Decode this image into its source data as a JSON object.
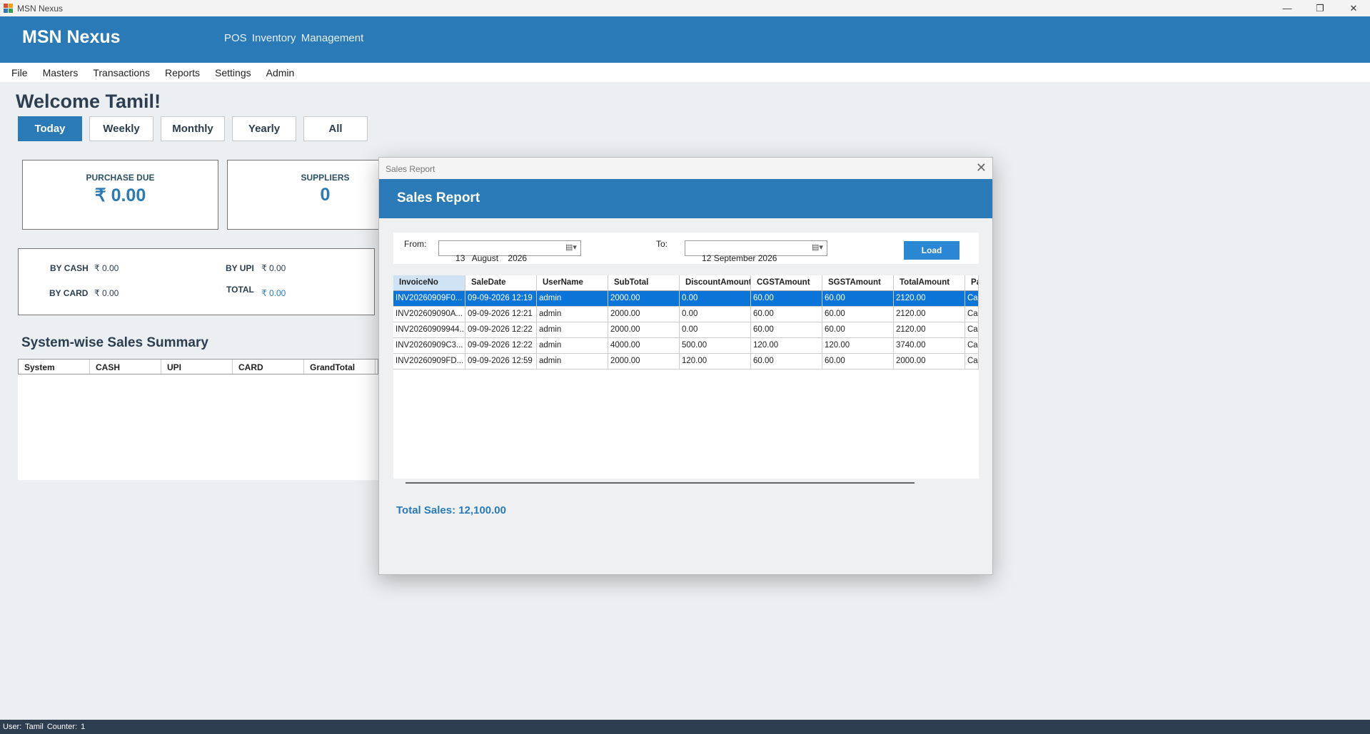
{
  "window": {
    "title": "MSN Nexus",
    "minimize": "—",
    "restore": "❐",
    "close": "✕"
  },
  "header": {
    "brand": "MSN Nexus",
    "subtitle": "POS Inventory Management"
  },
  "menu": [
    "File",
    "Masters",
    "Transactions",
    "Reports",
    "Settings",
    "Admin"
  ],
  "welcome": "Welcome Tamil!",
  "periods": [
    {
      "label": "Today",
      "active": true
    },
    {
      "label": "Weekly",
      "active": false
    },
    {
      "label": "Monthly",
      "active": false
    },
    {
      "label": "Yearly",
      "active": false
    },
    {
      "label": "All",
      "active": false
    }
  ],
  "cards": {
    "purchase_due": {
      "label": "PURCHASE DUE",
      "value": "₹ 0.00"
    },
    "suppliers": {
      "label": "SUPPLIERS",
      "value": "0"
    }
  },
  "payments": {
    "by_cash_label": "BY CASH",
    "by_cash": "₹ 0.00",
    "by_upi_label": "BY UPI",
    "by_upi": "₹ 0.00",
    "by_card_label": "BY CARD",
    "by_card": "₹ 0.00",
    "total_label": "TOTAL",
    "total": "₹ 0.00"
  },
  "summary": {
    "title": "System-wise Sales Summary",
    "columns": [
      "System",
      "CASH",
      "UPI",
      "CARD",
      "GrandTotal"
    ]
  },
  "dialog": {
    "window_title": "Sales Report",
    "close_glyph": "✕",
    "header": "Sales Report",
    "from_label": "From:",
    "from_value": "13   August    2026",
    "to_label": "To:",
    "to_value": "12 September 2026",
    "calendar_glyph": "▤▾",
    "load_label": "Load",
    "columns": [
      "InvoiceNo",
      "SaleDate",
      "UserName",
      "SubTotal",
      "DiscountAmount",
      "CGSTAmount",
      "SGSTAmount",
      "TotalAmount",
      "Pa"
    ],
    "rows": [
      [
        "INV20260909F0...",
        "09-09-2026 12:19",
        "admin",
        "2000.00",
        "0.00",
        "60.00",
        "60.00",
        "2120.00",
        "Ca"
      ],
      [
        "INV2026090​90A...",
        "09-09-2026 12:21",
        "admin",
        "2000.00",
        "0.00",
        "60.00",
        "60.00",
        "2120.00",
        "Ca"
      ],
      [
        "INV20260909944...",
        "09-09-2026 12:22",
        "admin",
        "2000.00",
        "0.00",
        "60.00",
        "60.00",
        "2120.00",
        "Ca"
      ],
      [
        "INV20260909C3...",
        "09-09-2026 12:22",
        "admin",
        "4000.00",
        "500.00",
        "120.00",
        "120.00",
        "3740.00",
        "Ca"
      ],
      [
        "INV20260909FD...",
        "09-09-2026 12:59",
        "admin",
        "2000.00",
        "120.00",
        "60.00",
        "60.00",
        "2000.00",
        "Ca"
      ]
    ],
    "selected_row": 0,
    "total_sales": "Total Sales: 12,100.00"
  },
  "status": "User: Tamil  Counter: 1"
}
